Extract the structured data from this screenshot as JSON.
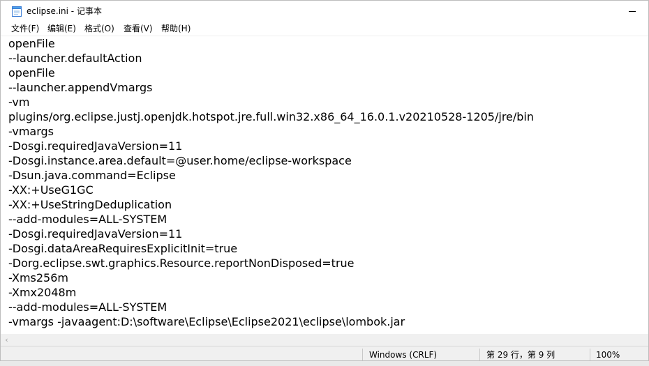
{
  "window": {
    "title": "eclipse.ini - 记事本",
    "icons": {
      "app": "notepad-icon",
      "minimize": "minimize-icon",
      "scroll_left": "chevron-left-icon"
    }
  },
  "menu": {
    "items": [
      {
        "label": "文件(F)"
      },
      {
        "label": "编辑(E)"
      },
      {
        "label": "格式(O)"
      },
      {
        "label": "查看(V)"
      },
      {
        "label": "帮助(H)"
      }
    ]
  },
  "editor": {
    "lines": [
      "openFile",
      "--launcher.defaultAction",
      "openFile",
      "--launcher.appendVmargs",
      "-vm",
      "plugins/org.eclipse.justj.openjdk.hotspot.jre.full.win32.x86_64_16.0.1.v20210528-1205/jre/bin",
      "-vmargs",
      "-Dosgi.requiredJavaVersion=11",
      "-Dosgi.instance.area.default=@user.home/eclipse-workspace",
      "-Dsun.java.command=Eclipse",
      "-XX:+UseG1GC",
      "-XX:+UseStringDeduplication",
      "--add-modules=ALL-SYSTEM",
      "-Dosgi.requiredJavaVersion=11",
      "-Dosgi.dataAreaRequiresExplicitInit=true",
      "-Dorg.eclipse.swt.graphics.Resource.reportNonDisposed=true",
      "-Xms256m",
      "-Xmx2048m",
      "--add-modules=ALL-SYSTEM",
      "-vmargs -javaagent:D:\\software\\Eclipse\\Eclipse2021\\eclipse\\lombok.jar"
    ]
  },
  "status": {
    "line_ending": "Windows (CRLF)",
    "position": "第 29 行，第 9 列",
    "zoom": "100%"
  }
}
